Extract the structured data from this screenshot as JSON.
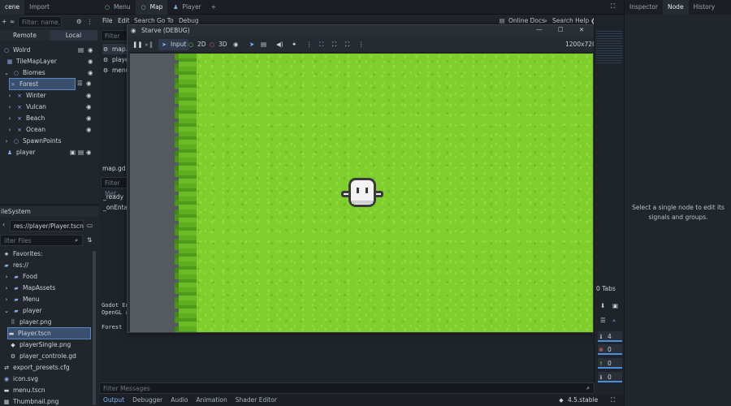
{
  "top_tabs": {
    "scene": "cene",
    "import": "Import",
    "menu": "Menu",
    "map": "Map",
    "player": "Player",
    "add": "+"
  },
  "menubar": [
    "File",
    "Edit",
    "Search",
    "Go To",
    "Debug"
  ],
  "help": {
    "online_docs": "Online Docs",
    "search_help": "Search Help"
  },
  "scene_panel": {
    "filter_placeholder": "Filter: name, t:t",
    "remote": "Remote",
    "local": "Local",
    "nodes": [
      {
        "label": "Wolrd",
        "depth": 0
      },
      {
        "label": "TileMapLayer",
        "depth": 1
      },
      {
        "label": "Biomes",
        "depth": 0
      },
      {
        "label": "Forest",
        "depth": 1
      },
      {
        "label": "Winter",
        "depth": 1
      },
      {
        "label": "Vulcan",
        "depth": 1
      },
      {
        "label": "Beach",
        "depth": 1
      },
      {
        "label": "Ocean",
        "depth": 1
      },
      {
        "label": "SpawnPoints",
        "depth": 0
      },
      {
        "label": "player",
        "depth": 0
      }
    ]
  },
  "filesystem": {
    "title": "ileSystem",
    "path": "res://player/Player.tscn",
    "filter_placeholder": "ilter Files",
    "favorites": "Favorites:",
    "res": "res://",
    "items": [
      {
        "label": "Food",
        "type": "folder"
      },
      {
        "label": "MapAssets",
        "type": "folder"
      },
      {
        "label": "Menu",
        "type": "folder"
      },
      {
        "label": "player",
        "type": "folder"
      },
      {
        "label": "player.png",
        "type": "file"
      },
      {
        "label": "Player.tscn",
        "type": "scene"
      },
      {
        "label": "playerSingle.png",
        "type": "file"
      },
      {
        "label": "player_controle.gd",
        "type": "script"
      },
      {
        "label": "export_presets.cfg",
        "type": "file"
      },
      {
        "label": "icon.svg",
        "type": "file"
      },
      {
        "label": "menu.tscn",
        "type": "scene"
      },
      {
        "label": "Thumbnail.png",
        "type": "file"
      }
    ]
  },
  "script_panel": {
    "filter_scripts": "Filter Scr",
    "scripts": [
      "map.g",
      "player",
      "menu"
    ],
    "current_file": "map.gd",
    "filter_methods": "Filter Met",
    "methods": [
      "_ready",
      "_onEntar"
    ]
  },
  "output_log": [
    "Godot En",
    "OpenGL A",
    "",
    "Forest"
  ],
  "game_window": {
    "title": "Starve (DEBUG)",
    "input": "Input",
    "mode_2d": "2D",
    "mode_3d": "3D",
    "resolution": "1200x720"
  },
  "inspector": {
    "tabs": [
      "Inspector",
      "Node",
      "History"
    ],
    "message": "Select a single node to edit its signals and groups."
  },
  "bottom": {
    "filter_messages": "Filter Messages",
    "tabs": [
      "Output",
      "Debugger",
      "Audio",
      "Animation",
      "Shader Editor"
    ],
    "version": "4.5.stable"
  },
  "debug_panel": {
    "tabs_label": "Tabs",
    "counts": [
      "4",
      "0",
      "0",
      "0"
    ]
  },
  "colors": {
    "accent": "#4b8fe0",
    "grass": "#7fcf2c",
    "road": "#555a5e"
  }
}
